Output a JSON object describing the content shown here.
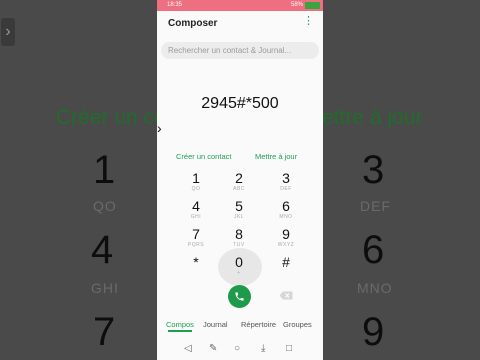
{
  "background": {
    "left_text": "Créer un co",
    "right_text": "ettre à jour",
    "left_digits": [
      {
        "digit": "1",
        "letters": "QO"
      },
      {
        "digit": "4",
        "letters": "GHI"
      },
      {
        "digit": "7",
        "letters": ""
      }
    ],
    "right_digits": [
      {
        "digit": "3",
        "letters": "DEF"
      },
      {
        "digit": "6",
        "letters": "MNO"
      },
      {
        "digit": "9",
        "letters": ""
      }
    ]
  },
  "status_bar": {
    "time": "18:35",
    "battery": "58%"
  },
  "app": {
    "title": "Composer",
    "search_placeholder": "Rechercher un contact & Journal...",
    "dialed_number": "2945#*500",
    "links": {
      "create_contact": "Créer un contact",
      "update": "Mettre à jour"
    },
    "keypad": [
      {
        "digit": "1",
        "letters": "QO"
      },
      {
        "digit": "2",
        "letters": "ABC"
      },
      {
        "digit": "3",
        "letters": "DEF"
      },
      {
        "digit": "4",
        "letters": "GHI"
      },
      {
        "digit": "5",
        "letters": "JKL"
      },
      {
        "digit": "6",
        "letters": "MNO"
      },
      {
        "digit": "7",
        "letters": "PQRS"
      },
      {
        "digit": "8",
        "letters": "TUV"
      },
      {
        "digit": "9",
        "letters": "WXYZ"
      },
      {
        "digit": "*",
        "letters": ""
      },
      {
        "digit": "0",
        "letters": "+"
      },
      {
        "digit": "#",
        "letters": ""
      }
    ],
    "tabs": [
      "Compos",
      "Journal",
      "Répertoire",
      "Groupes"
    ],
    "active_tab": "Compos",
    "accent_color": "#1e9e52"
  },
  "nav_icons": [
    "back-icon",
    "edit-icon",
    "home-icon",
    "download-icon",
    "recents-icon"
  ]
}
